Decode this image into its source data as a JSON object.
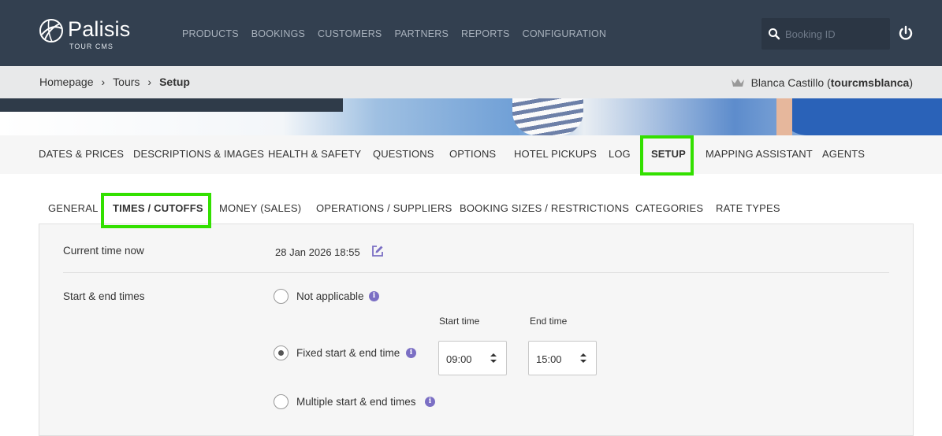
{
  "brand": {
    "name": "Palisis",
    "sub": "TOUR CMS"
  },
  "main_nav": [
    "PRODUCTS",
    "BOOKINGS",
    "CUSTOMERS",
    "PARTNERS",
    "REPORTS",
    "CONFIGURATION"
  ],
  "search": {
    "placeholder": "Booking ID"
  },
  "breadcrumb": {
    "home": "Homepage",
    "tours": "Tours",
    "current": "Setup"
  },
  "user": {
    "name": "Blanca Castillo",
    "username": "tourcmsblanca"
  },
  "tour_tabs": [
    "DATES & PRICES",
    "DESCRIPTIONS & IMAGES",
    "HEALTH & SAFETY",
    "QUESTIONS",
    "OPTIONS",
    "HOTEL PICKUPS",
    "LOG",
    "SETUP",
    "MAPPING ASSISTANT",
    "AGENTS"
  ],
  "sub_tabs": [
    "GENERAL",
    "TIMES / CUTOFFS",
    "MONEY (SALES)",
    "OPERATIONS / SUPPLIERS",
    "BOOKING SIZES / RESTRICTIONS",
    "CATEGORIES",
    "RATE TYPES"
  ],
  "current_time": {
    "label": "Current time now",
    "value": "28 Jan 2026 18:55"
  },
  "start_end": {
    "label": "Start & end times",
    "options": [
      "Not applicable",
      "Fixed start & end time",
      "Multiple start & end times"
    ],
    "selected": "Fixed start & end time",
    "start_label": "Start time",
    "end_label": "End time",
    "start_value": "09:00",
    "end_value": "15:00"
  },
  "colors": {
    "header": "#334050",
    "highlight": "#33e000",
    "info": "#7b6fc4"
  }
}
